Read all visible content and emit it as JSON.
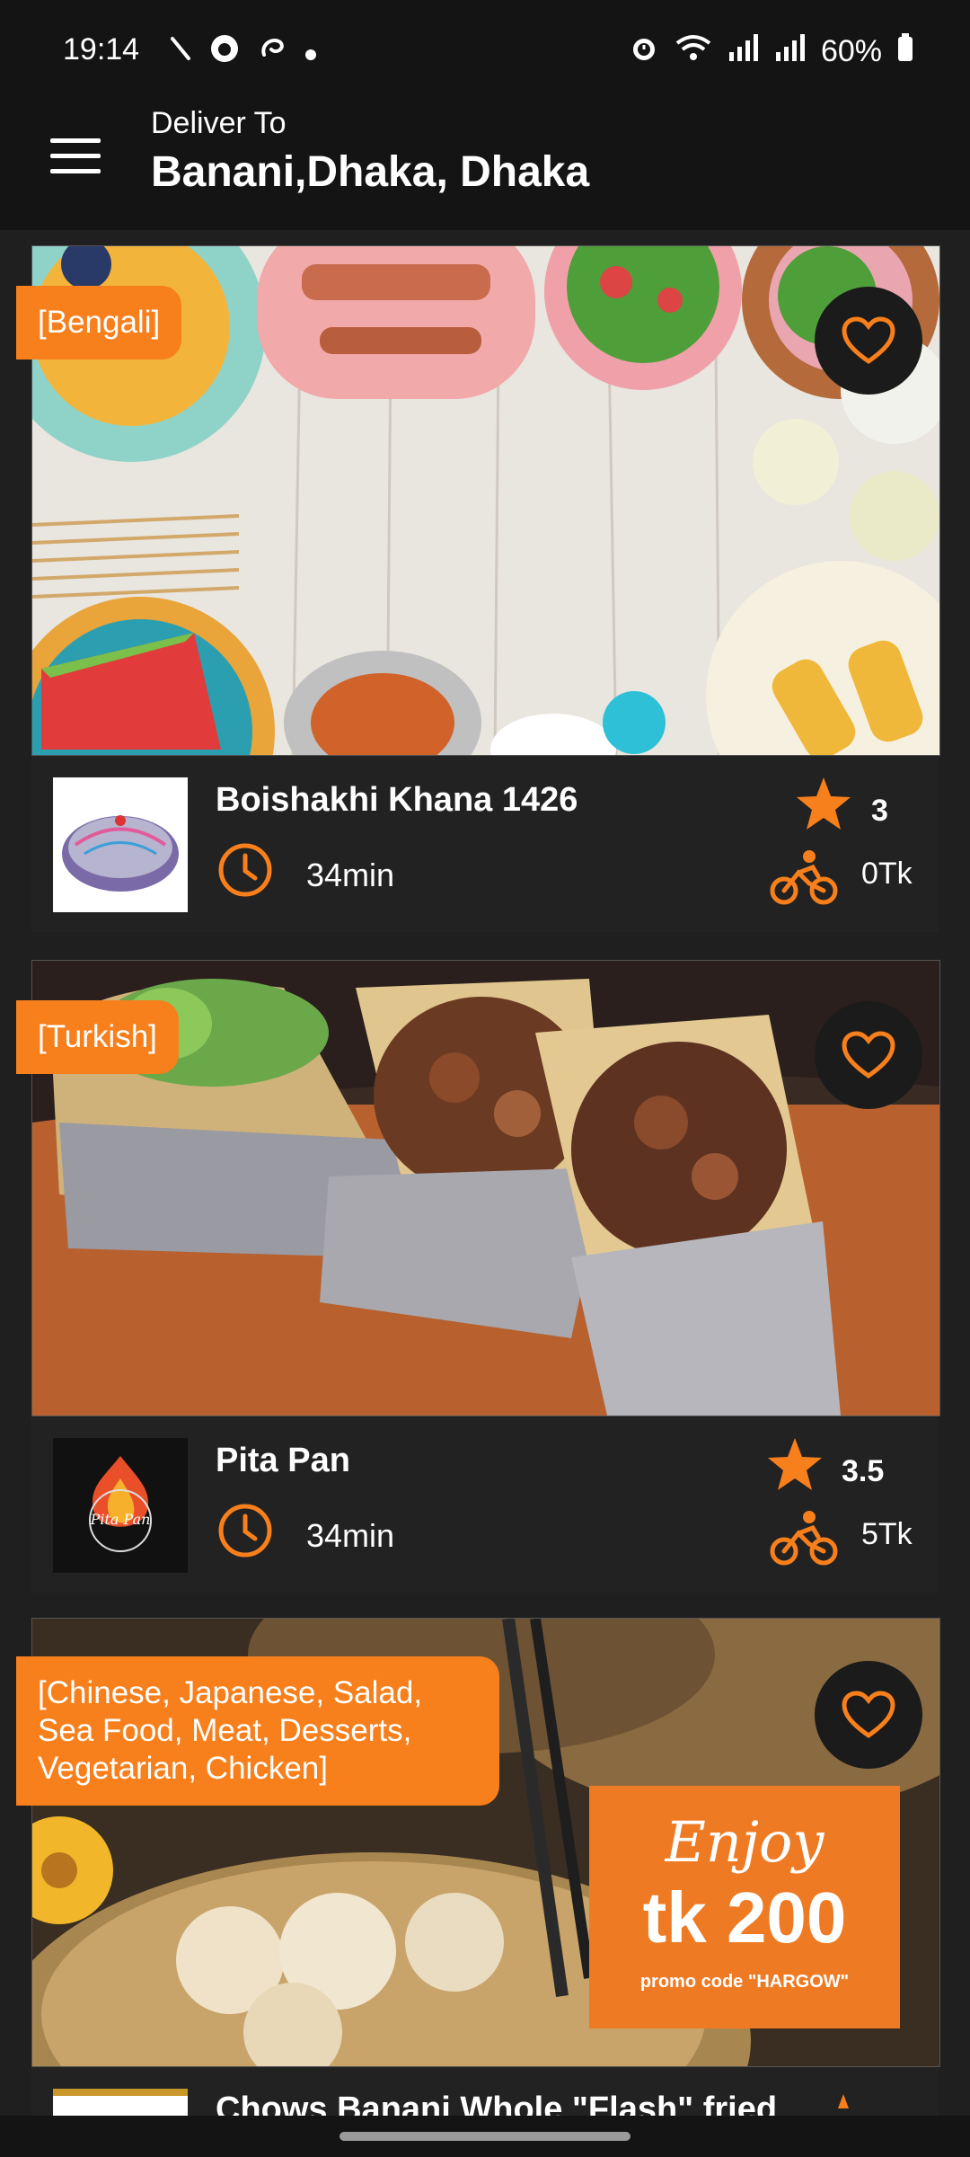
{
  "status_bar": {
    "time": "19:14",
    "battery": "60%"
  },
  "header": {
    "deliver_label": "Deliver To",
    "address": "Banani,Dhaka, Dhaka"
  },
  "restaurants": [
    {
      "cuisine": "[Bengali]",
      "name": "Boishakhi Khana 1426",
      "delivery_time": "34min",
      "rating": "3",
      "delivery_fee": "0Tk"
    },
    {
      "cuisine": "[Turkish]",
      "name": "Pita Pan",
      "delivery_time": "34min",
      "rating": "3.5",
      "delivery_fee": "5Tk",
      "logo_text": "Pita Pan"
    },
    {
      "cuisine": "[Chinese, Japanese, Salad, Sea Food, Meat, Desserts, Vegetarian, Chicken]",
      "name": "Chows Banani Whole \"Flash\" fried",
      "promo": {
        "line1": "Enjoy",
        "line2": "tk 200",
        "line3": "promo code \"HARGOW\""
      }
    }
  ],
  "colors": {
    "accent": "#f77f1c",
    "background": "#1f1f1f",
    "bar": "#141414"
  }
}
